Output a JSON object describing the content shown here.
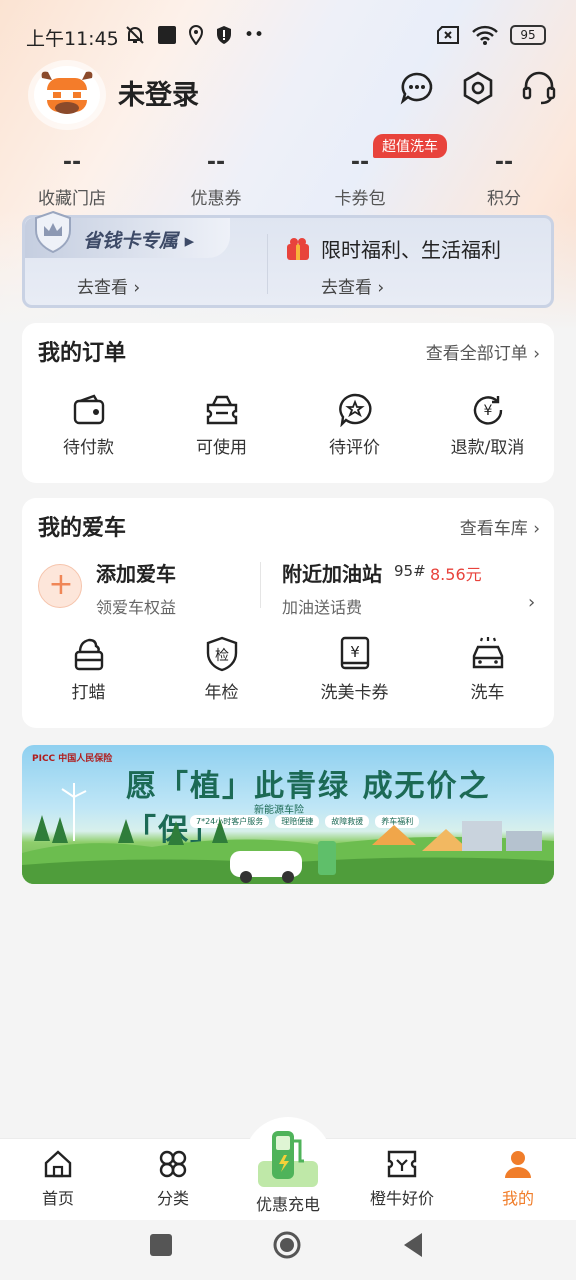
{
  "status_bar": {
    "time": "上午11:45",
    "battery": "95",
    "icons": [
      "bell-off-icon",
      "square-icon",
      "location-icon",
      "shield-icon",
      "more-dots-icon",
      "sim-x-icon",
      "wifi-icon",
      "battery-icon"
    ]
  },
  "header": {
    "username": "未登录",
    "icons": [
      "message-icon",
      "settings-icon",
      "headset-icon"
    ]
  },
  "stats": [
    {
      "value": "--",
      "label": "收藏门店"
    },
    {
      "value": "--",
      "label": "优惠券"
    },
    {
      "value": "--",
      "label": "卡券包",
      "badge": "超值洗车"
    },
    {
      "value": "--",
      "label": "积分"
    }
  ],
  "promo": {
    "left_tag": "省钱卡专属",
    "left_link": "去查看",
    "right_title": "限时福利、生活福利",
    "right_link": "去查看"
  },
  "orders": {
    "title": "我的订单",
    "more": "查看全部订单",
    "items": [
      {
        "label": "待付款",
        "icon": "wallet-icon"
      },
      {
        "label": "可使用",
        "icon": "ticket-icon"
      },
      {
        "label": "待评价",
        "icon": "star-chat-icon"
      },
      {
        "label": "退款/取消",
        "icon": "refund-icon"
      }
    ]
  },
  "car": {
    "title": "我的爱车",
    "more": "查看车库",
    "add_title": "添加爱车",
    "add_sub": "领爱车权益",
    "gas_title": "附近加油站",
    "gas_grade": "95#",
    "gas_price": "8.56元",
    "gas_sub": "加油送话费",
    "items": [
      {
        "label": "打蜡",
        "icon": "wax-icon"
      },
      {
        "label": "年检",
        "icon": "inspection-shield-icon",
        "icon_text": "检"
      },
      {
        "label": "洗美卡券",
        "icon": "yuan-book-icon",
        "icon_text": "¥"
      },
      {
        "label": "洗车",
        "icon": "car-wash-icon"
      }
    ]
  },
  "banner": {
    "logo": "PICC 中国人民保险",
    "headline": "愿「植」此青绿  成无价之「保」",
    "subtitle": "新能源车险",
    "pills": [
      "7*24小时客户服务",
      "理赔便捷",
      "故障救援",
      "养车福利"
    ]
  },
  "bottom_nav": [
    {
      "label": "首页",
      "icon": "home-icon"
    },
    {
      "label": "分类",
      "icon": "grid-icon"
    },
    {
      "label": "优惠充电",
      "icon": "charging-station-icon"
    },
    {
      "label": "橙牛好价",
      "icon": "price-tag-icon"
    },
    {
      "label": "我的",
      "icon": "person-icon",
      "active": true
    }
  ],
  "colors": {
    "accent": "#f07d2a",
    "price_red": "#e8433c",
    "promo_blue": "#dfe5f1"
  }
}
